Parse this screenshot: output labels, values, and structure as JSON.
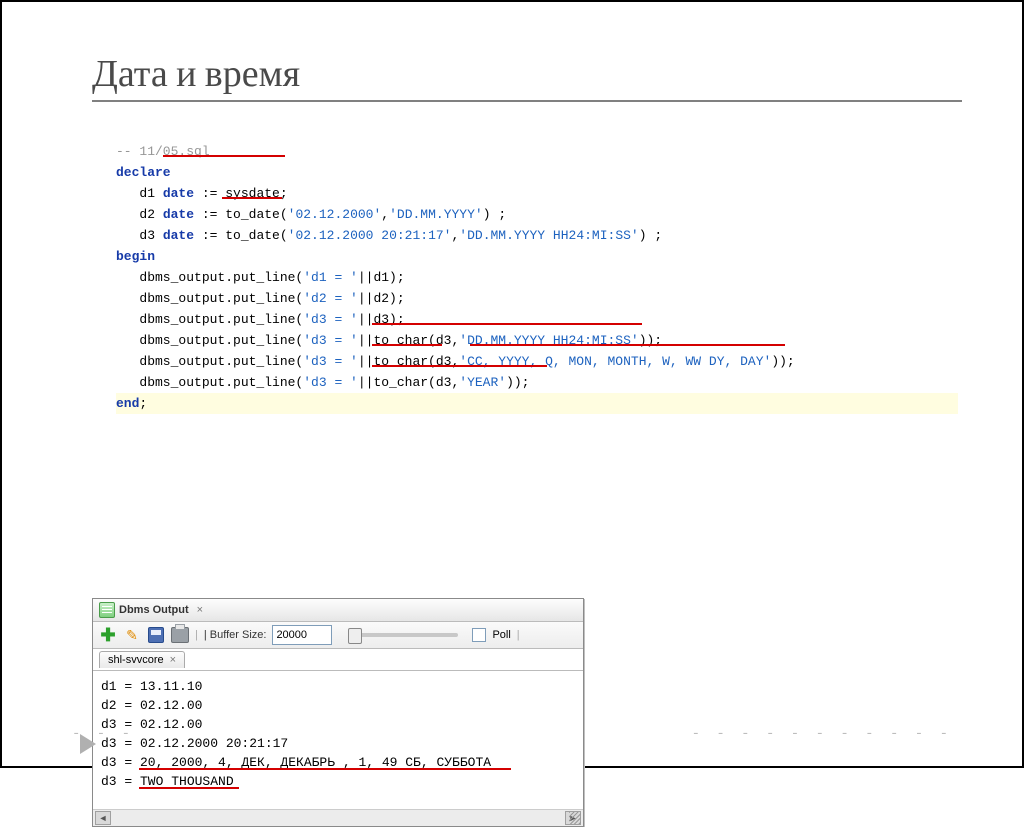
{
  "title": "Дата и время",
  "code": {
    "l1": "-- 11/05.sql",
    "l2a": "declare",
    "l3a": "   d1 ",
    "l3kw": "date",
    "l3b": " := sysdate;",
    "l4a": "   d2 ",
    "l4kw": "date",
    "l4b": " := to_date(",
    "l4s1": "'02.12.2000'",
    "l4c": ",",
    "l4s2": "'DD.MM.YYYY'",
    "l4d": ") ;",
    "l5a": "   d3 ",
    "l5kw": "date",
    "l5b": " := to_date(",
    "l5s1": "'02.12.2000 20:21:17'",
    "l5c": ",",
    "l5s2": "'DD.MM.YYYY HH24:MI:SS'",
    "l5d": ") ;",
    "l6a": "begin",
    "l7p": "   dbms_output.put_line(",
    "l7s": "'d1 = '",
    "l7e": "||d1);",
    "l8p": "   dbms_output.put_line(",
    "l8s": "'d2 = '",
    "l8e": "||d2);",
    "l9p": "   dbms_output.put_line(",
    "l9s": "'d3 = '",
    "l9e": "||d3);",
    "l10p": "   dbms_output.put_line(",
    "l10s": "'d3 = '",
    "l10m": "||to_char(d3,",
    "l10s2": "'DD.MM.YYYY HH24:MI:SS'",
    "l10e": "));",
    "l11p": "   dbms_output.put_line(",
    "l11s": "'d3 = '",
    "l11m": "||to_char(d3,",
    "l11s2": "'CC, YYYY, Q, MON, MONTH, W, WW DY, DAY'",
    "l11e": "));",
    "l12p": "   dbms_output.put_line(",
    "l12s": "'d3 = '",
    "l12m": "||to_char(d3,",
    "l12s2": "'YEAR'",
    "l12e": "));",
    "l13a": "end",
    "l13b": ";"
  },
  "out": {
    "title": "Dbms Output",
    "buffer_label": "| Buffer Size:",
    "buffer_value": "20000",
    "poll_label": "Poll",
    "tab": "shl-svvcore",
    "line1": "d1 = 13.11.10",
    "line2": "d2 = 02.12.00",
    "line3": "d3 = 02.12.00",
    "line4": "d3 = 02.12.2000 20:21:17",
    "line5": "d3 = 20, 2000, 4, ДЕК, ДЕКАБРЬ , 1, 49 СБ, СУББОТА",
    "line6": "d3 = TWO THOUSAND"
  },
  "footer": {
    "dash_left": "- - -",
    "dash_right": "- - - - - - - - - - -"
  }
}
